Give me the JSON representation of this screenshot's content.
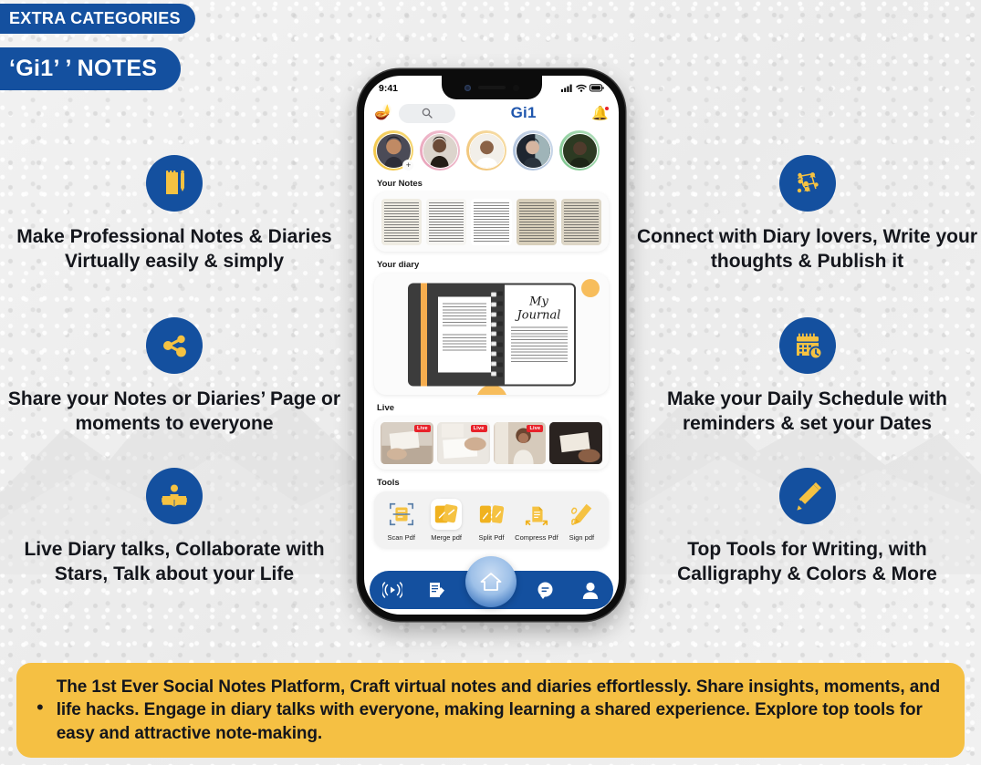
{
  "theme": {
    "brand_blue": "#14509f",
    "accent_gold": "#f5c242",
    "banner_yellow": "#f5c043",
    "live_red": "#e8222a",
    "text_dark": "#14161c",
    "background": "#efefef"
  },
  "badges": {
    "eyebrow": "EXTRA CATEGORIES",
    "title": "‘Gi1’ ’ NOTES"
  },
  "features": [
    {
      "id": "notes",
      "side": "left",
      "icon": "notepad-pencil-icon",
      "text": "Make Professional Notes & Diaries Virtually easily & simply"
    },
    {
      "id": "share",
      "side": "left",
      "icon": "share-nodes-icon",
      "text": "Share your Notes or Diaries’ Page or moments to everyone"
    },
    {
      "id": "live",
      "side": "left",
      "icon": "person-reading-icon",
      "text": "Live Diary talks, Collaborate with Stars, Talk about your Life"
    },
    {
      "id": "connect",
      "side": "right",
      "icon": "network-people-icon",
      "text": "Connect with Diary lovers, Write your thoughts & Publish it"
    },
    {
      "id": "schedule",
      "side": "right",
      "icon": "calendar-clock-icon",
      "text": "Make your Daily Schedule with reminders & set your Dates"
    },
    {
      "id": "tools",
      "side": "right",
      "icon": "pencil-icon",
      "text": "Top Tools for Writing, with Calligraphy & Colors & More"
    }
  ],
  "phone": {
    "status_bar": {
      "time": "9:41",
      "icons": [
        "cellular-signal-icon",
        "wifi-icon",
        "battery-icon"
      ]
    },
    "app_header": {
      "lamp_icon": "genie-lamp-icon",
      "search_placeholder": "",
      "search_icon": "search-icon",
      "title": "Gi1",
      "bell_icon": "bell-icon",
      "bell_has_badge": true
    },
    "stories": [
      {
        "name": "story-1",
        "ring": "#f2c23c",
        "has_add": true,
        "skin": "#c08a64",
        "bg": "#4b4b57"
      },
      {
        "name": "story-2",
        "ring": "#e8a0b8",
        "has_add": false,
        "skin": "#6b4a37",
        "bg": "#dcd4cc"
      },
      {
        "name": "story-3",
        "ring": "#f0c070",
        "has_add": false,
        "skin": "#8a6246",
        "bg": "#f2efe9"
      },
      {
        "name": "story-4",
        "ring": "#a8bcd8",
        "has_add": false,
        "skin": "#d5b5a0",
        "bg": "#1e2630"
      },
      {
        "name": "story-5",
        "ring": "#78c48a",
        "has_add": false,
        "skin": "#4f3b2c",
        "bg": "#2c3a22"
      }
    ],
    "sections": {
      "notes_label": "Your Notes",
      "diary_label": "Your diary",
      "live_label": "Live",
      "tools_label": "Tools"
    },
    "notes_thumbs": [
      {
        "name": "note-1",
        "paper": "#efece3"
      },
      {
        "name": "note-2",
        "paper": "#f6f5f2"
      },
      {
        "name": "note-3",
        "paper": "#ffffff"
      },
      {
        "name": "note-4",
        "paper": "#d8cfbb"
      },
      {
        "name": "note-5",
        "paper": "#ddd6c6"
      }
    ],
    "diary": {
      "journal_title": "My Journal",
      "cover_color": "#3c3c3c",
      "bookmark_color": "#f6ad4e"
    },
    "live_items": [
      {
        "name": "live-1",
        "badge": "Live",
        "bg": "#cfc2b4"
      },
      {
        "name": "live-2",
        "badge": "Live",
        "bg": "#e6e2dc"
      },
      {
        "name": "live-3",
        "badge": "Live",
        "bg": "#d9cdbf"
      },
      {
        "name": "live-4",
        "badge": "",
        "bg": "#2a2320"
      }
    ],
    "tools": [
      {
        "name": "scan-pdf",
        "label": "Scan Pdf",
        "icon": "scan-document-icon",
        "boxed": false
      },
      {
        "name": "merge-pdf",
        "label": "Merge pdf",
        "icon": "merge-pages-icon",
        "boxed": true
      },
      {
        "name": "split-pdf",
        "label": "Split Pdf",
        "icon": "split-pages-icon",
        "boxed": false
      },
      {
        "name": "compress-pdf",
        "label": "Compress Pdf",
        "icon": "compress-file-icon",
        "boxed": false
      },
      {
        "name": "sign-pdf",
        "label": "Sign pdf",
        "icon": "signature-pen-icon",
        "boxed": false
      }
    ],
    "tabbar": [
      {
        "name": "tab-live",
        "icon": "broadcast-icon"
      },
      {
        "name": "tab-write",
        "icon": "write-note-icon"
      },
      {
        "name": "tab-home",
        "icon": "home-icon",
        "active": true
      },
      {
        "name": "tab-messages",
        "icon": "chat-bubble-icon"
      },
      {
        "name": "tab-profile",
        "icon": "person-icon"
      }
    ]
  },
  "banner": {
    "bullet": "•",
    "text": "The 1st Ever Social Notes Platform, Craft virtual notes and diaries effortlessly. Share insights, moments, and life hacks. Engage in diary talks with everyone, making learning a shared experience. Explore top tools for easy and attractive note-making."
  }
}
